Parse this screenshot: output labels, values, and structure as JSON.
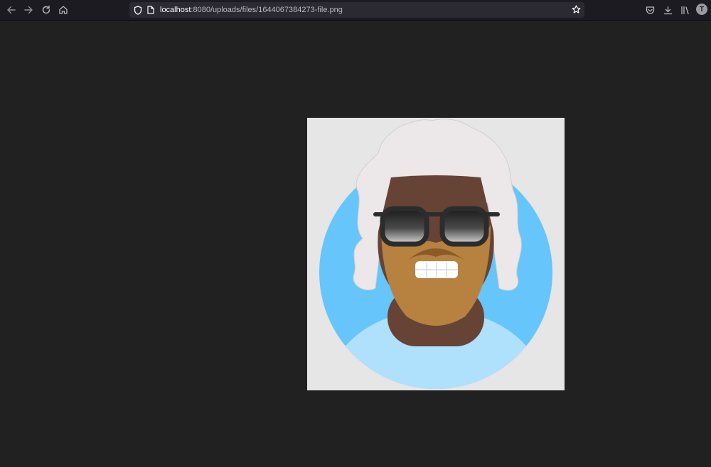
{
  "browser": {
    "url_host": "localhost",
    "url_rest": ":8080/uploads/files/1644067384273-file.png",
    "account_initial": "T",
    "icons": {
      "back": "arrow-left-icon",
      "forward": "arrow-right-icon",
      "reload": "reload-icon",
      "home": "home-icon",
      "tracking_protection": "shield-icon",
      "page_info": "page-icon",
      "bookmark": "star-icon",
      "pocket": "pocket-icon",
      "downloads": "download-icon",
      "library": "library-icon"
    }
  },
  "viewer": {
    "background": "#212121",
    "image_description_colors": {
      "circle": "#66c5fb",
      "shirt": "#afe0fc",
      "skin": "#664334",
      "beard": "#b7823f",
      "hair": "#ece7e8"
    }
  }
}
